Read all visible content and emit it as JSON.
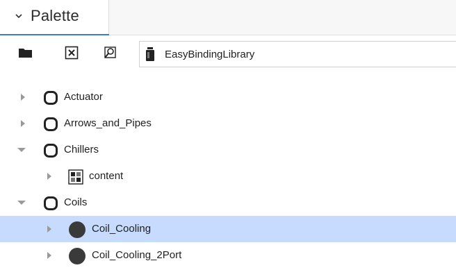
{
  "header": {
    "title": "Palette",
    "collapse_icon": "chevron-down-icon"
  },
  "toolbar": {
    "open_icon": "folder-icon",
    "close_icon": "close-box-icon",
    "find_icon": "find-icon",
    "selected_palette": "EasyBindingLibrary",
    "palette_icon": "jar-icon"
  },
  "tree": {
    "items": [
      {
        "label": "Actuator",
        "expanded": false,
        "icon": "folder-node-icon",
        "depth": 0
      },
      {
        "label": "Arrows_and_Pipes",
        "expanded": false,
        "icon": "folder-node-icon",
        "depth": 0
      },
      {
        "label": "Chillers",
        "expanded": true,
        "icon": "folder-node-icon",
        "depth": 0
      },
      {
        "label": "content",
        "expanded": false,
        "icon": "content-icon",
        "depth": 1
      },
      {
        "label": "Coils",
        "expanded": true,
        "icon": "folder-node-icon",
        "depth": 0
      },
      {
        "label": "Coil_Cooling",
        "expanded": false,
        "icon": "component-icon",
        "depth": 1,
        "selected": true
      },
      {
        "label": "Coil_Cooling_2Port",
        "expanded": false,
        "icon": "component-icon",
        "depth": 1
      }
    ]
  },
  "colors": {
    "selection": "#c6dbfd",
    "accent": "#3a7bd5",
    "icon": "#222222",
    "caret": "#9a9a9a"
  }
}
